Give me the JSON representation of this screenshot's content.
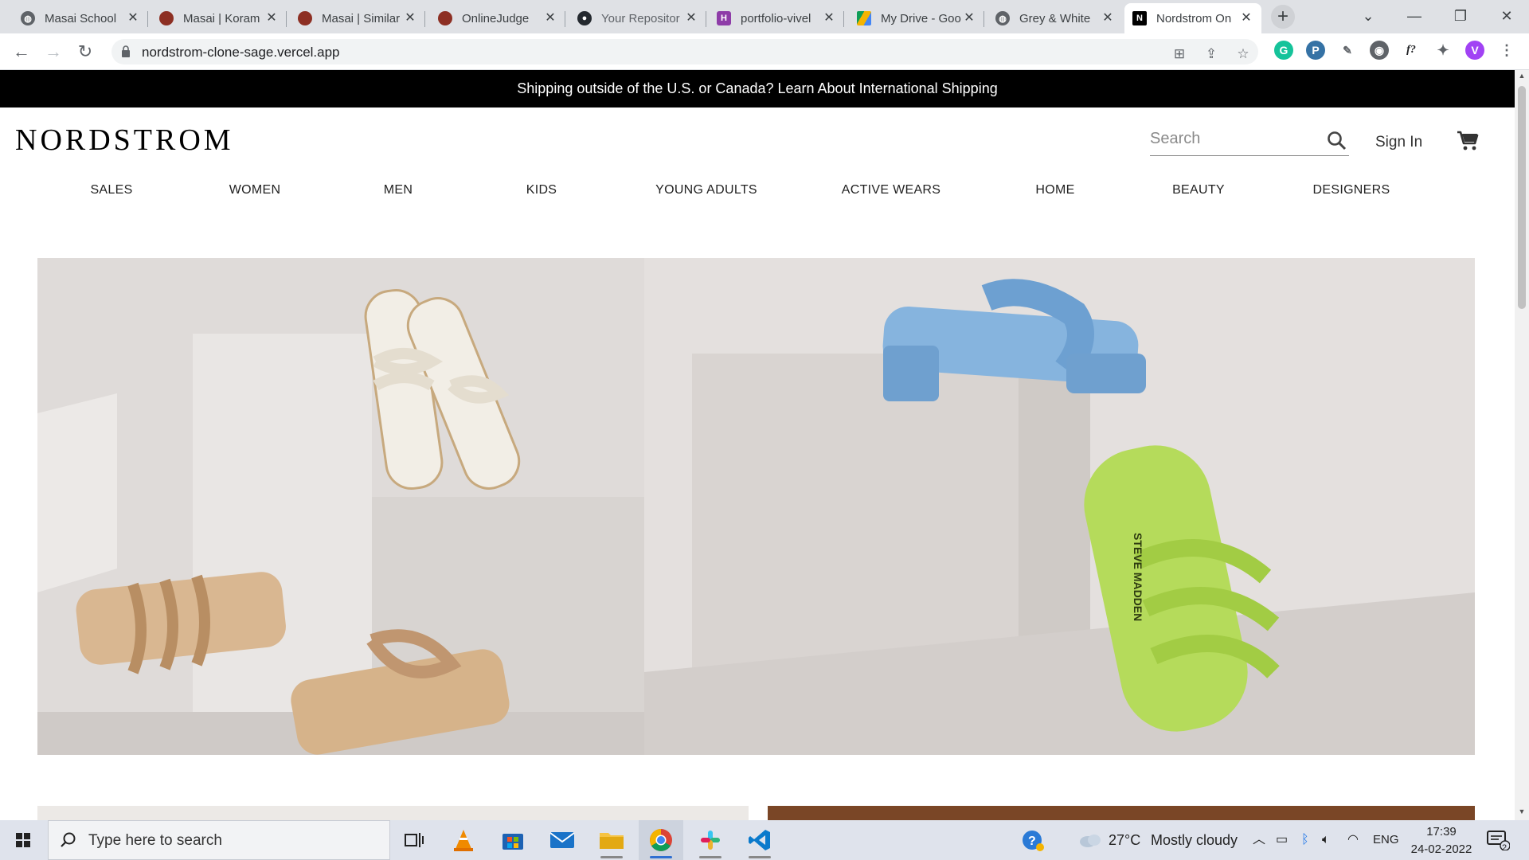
{
  "browser": {
    "tabs": [
      {
        "title": "Masai School",
        "favicon_color": "#5f6368"
      },
      {
        "title": "Masai | Koram",
        "favicon_color": "#8d2f23"
      },
      {
        "title": "Masai | Similar",
        "favicon_color": "#8d2f23"
      },
      {
        "title": "OnlineJudge",
        "favicon_color": "#8d2f23"
      },
      {
        "title": "Your Repositor",
        "favicon_color": "#24292f"
      },
      {
        "title": "portfolio-vivel",
        "favicon_color": "#8e3ca8"
      },
      {
        "title": "My Drive - Goo",
        "favicon_color": "#1a73e8"
      },
      {
        "title": "Grey & White",
        "favicon_color": "#5f6368"
      },
      {
        "title": "Nordstrom On",
        "favicon_color": "#000000"
      }
    ],
    "active_tab_index": 8,
    "url": "nordstrom-clone-sage.vercel.app",
    "profile_initial": "V"
  },
  "site": {
    "banner": "Shipping outside of the U.S. or Canada? Learn About International Shipping",
    "logo": "NORDSTROM",
    "search_placeholder": "Search",
    "sign_in": "Sign In",
    "nav": [
      "SALES",
      "WOMEN",
      "MEN",
      "KIDS",
      "YOUNG ADULTS",
      "ACTIVE WEARS",
      "HOME",
      "BEAUTY",
      "DESIGNERS"
    ],
    "hero_brand_text": "STEVE MADDEN"
  },
  "taskbar": {
    "search_placeholder": "Type here to search",
    "weather_temp": "27°C",
    "weather_desc": "Mostly cloudy",
    "language": "ENG",
    "time": "17:39",
    "date": "24-02-2022",
    "notification_count": "2"
  },
  "colors": {
    "banner_bg": "#000000",
    "accent": "#1a73e8",
    "tab_strip": "#dfe1e5"
  }
}
